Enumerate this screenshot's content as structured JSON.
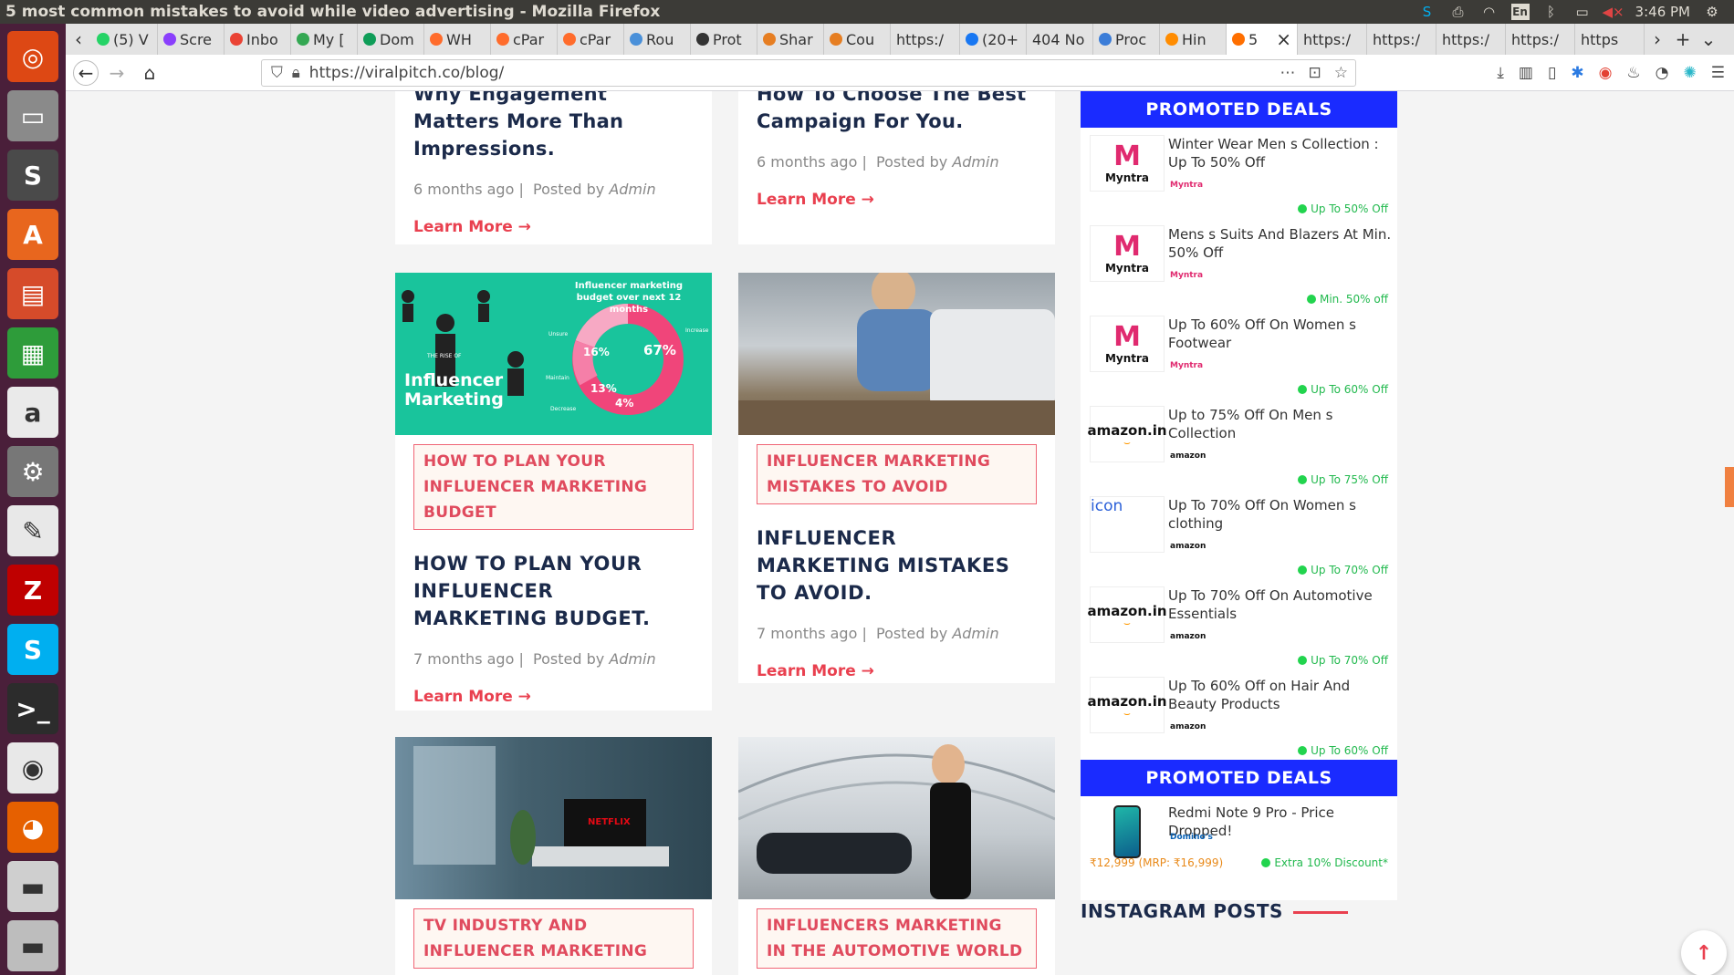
{
  "os": {
    "window_title": "5 most common mistakes to avoid while video advertising - Mozilla Firefox",
    "time": "3:46 PM",
    "lang": "En"
  },
  "launcher": [
    {
      "name": "ubuntu-dash",
      "glyph": "◎",
      "bg": "#dd4814"
    },
    {
      "name": "files",
      "glyph": "▭",
      "bg": "#8a8a8a"
    },
    {
      "name": "sublime",
      "glyph": "S",
      "bg": "#4a4a4a"
    },
    {
      "name": "software-center",
      "glyph": "A",
      "bg": "#e8661e"
    },
    {
      "name": "impress",
      "glyph": "▤",
      "bg": "#d64b2a"
    },
    {
      "name": "calc",
      "glyph": "▦",
      "bg": "#2e9c3a"
    },
    {
      "name": "amazon",
      "glyph": "a",
      "bg": "#eaeaea"
    },
    {
      "name": "settings",
      "glyph": "⚙",
      "bg": "#777"
    },
    {
      "name": "text-editor",
      "glyph": "✎",
      "bg": "#e8e8e8"
    },
    {
      "name": "filezilla",
      "glyph": "Z",
      "bg": "#bf0000"
    },
    {
      "name": "skype",
      "glyph": "S",
      "bg": "#00aff0"
    },
    {
      "name": "terminal",
      "glyph": ">_",
      "bg": "#2c2c2c"
    },
    {
      "name": "chrome",
      "glyph": "◉",
      "bg": "#e8e8e8"
    },
    {
      "name": "firefox",
      "glyph": "◕",
      "bg": "#e66000"
    },
    {
      "name": "drive",
      "glyph": "▬",
      "bg": "#cfcfcf"
    },
    {
      "name": "drive2",
      "glyph": "▬",
      "bg": "#bdbdbd"
    }
  ],
  "tabs": [
    {
      "label": "(5) V",
      "color": "#25d366"
    },
    {
      "label": "Scre",
      "color": "#8a3ffc"
    },
    {
      "label": "Inbo",
      "color": "#ea4335"
    },
    {
      "label": "My [",
      "color": "#34a853"
    },
    {
      "label": "Dom",
      "color": "#0f9d58"
    },
    {
      "label": "WH",
      "color": "#ff6c2c"
    },
    {
      "label": "cPar",
      "color": "#ff6c2c"
    },
    {
      "label": "cPar",
      "color": "#ff6c2c"
    },
    {
      "label": "Rou",
      "color": "#4a90d9"
    },
    {
      "label": "Prot",
      "color": "#333"
    },
    {
      "label": "Shar",
      "color": "#e67e22"
    },
    {
      "label": "Cou",
      "color": "#e67e22"
    },
    {
      "label": "https:/",
      "color": ""
    },
    {
      "label": "(20+",
      "color": "#1877f2"
    },
    {
      "label": "404 No",
      "color": ""
    },
    {
      "label": "Proc",
      "color": "#3b7dd8"
    },
    {
      "label": "Hin",
      "color": "#ff8c00"
    },
    {
      "label": "5",
      "color": "#ff6f00",
      "active": true
    },
    {
      "label": "https:/",
      "color": ""
    },
    {
      "label": "https:/",
      "color": ""
    },
    {
      "label": "https:/",
      "color": ""
    },
    {
      "label": "https:/",
      "color": ""
    },
    {
      "label": "https",
      "color": ""
    }
  ],
  "url": "https://viralpitch.co/blog/",
  "cards": [
    {
      "title": "Why Engagement Matters More Than Impressions.",
      "time": "6 months ago",
      "by": "Posted by",
      "author": "Admin",
      "learn": "Learn More →"
    },
    {
      "title": "How To Choose The Best Campaign For You.",
      "time": "6 months ago",
      "by": "Posted by",
      "author": "Admin",
      "learn": "Learn More →"
    },
    {
      "category": "HOW TO PLAN YOUR INFLUENCER MARKETING BUDGET",
      "title": "HOW TO PLAN YOUR INFLUENCER MARKETING BUDGET.",
      "time": "7 months ago",
      "by": "Posted by",
      "author": "Admin",
      "learn": "Learn More →",
      "image_text": {
        "budget": "Influencer marketing budget over next 12 months",
        "rise": "THE RISE OF",
        "infl": "Influencer",
        "mkt": "Marketing",
        "p67": "67%",
        "p16": "16%",
        "p13": "13%",
        "p4": "4%",
        "unsure": "Unsure",
        "maintain": "Maintain",
        "decrease": "Decrease",
        "increase": "Increase"
      }
    },
    {
      "category": "INFLUENCER MARKETING MISTAKES TO AVOID",
      "title": "INFLUENCER MARKETING MISTAKES TO AVOID.",
      "time": "7 months ago",
      "by": "Posted by",
      "author": "Admin",
      "learn": "Learn More →"
    },
    {
      "category": "TV INDUSTRY AND INFLUENCER MARKETING",
      "image_text": {
        "netflix": "NETFLIX"
      }
    },
    {
      "category": "INFLUENCERS MARKETING IN THE AUTOMOTIVE WORLD"
    }
  ],
  "sidebar": {
    "promo_heading": "PROMOTED DEALS",
    "deals": [
      {
        "title": "Winter Wear Men s Collection : Up To 50% Off",
        "logo": "Myntra",
        "brand": "Myntra",
        "offer": "Up To 50% Off"
      },
      {
        "title": "Mens s Suits And Blazers At Min. 50% Off",
        "logo": "Myntra",
        "brand": "Myntra",
        "offer": "Min. 50% off"
      },
      {
        "title": "Up To 60% Off On Women s Footwear",
        "logo": "Myntra",
        "brand": "Myntra",
        "offer": "Up To 60% Off"
      },
      {
        "title": "Up to 75% Off On Men s Collection",
        "logo": "amazon.in",
        "brand": "amazon",
        "offer": "Up To 75% Off"
      },
      {
        "title": "Up To 70% Off On Women s clothing",
        "logo": "icon",
        "brand": "amazon",
        "offer": "Up To 70% Off"
      },
      {
        "title": "Up To 70% Off On Automotive Essentials",
        "logo": "amazon.in",
        "brand": "amazon",
        "offer": "Up To 70% Off"
      },
      {
        "title": "Up To 60% Off on Hair And Beauty Products",
        "logo": "amazon.in",
        "brand": "amazon",
        "offer": "Up To 60% Off"
      }
    ],
    "promo_heading2": "PROMOTED DEALS",
    "deal2": {
      "title": "Redmi Note 9 Pro - Price Dropped!",
      "brand": "Domino's",
      "price": "₹12,999 (MRP: ₹16,999)",
      "offer": "Extra 10% Discount*"
    },
    "instagram": "INSTAGRAM POSTS"
  },
  "scroll_up": "↑"
}
